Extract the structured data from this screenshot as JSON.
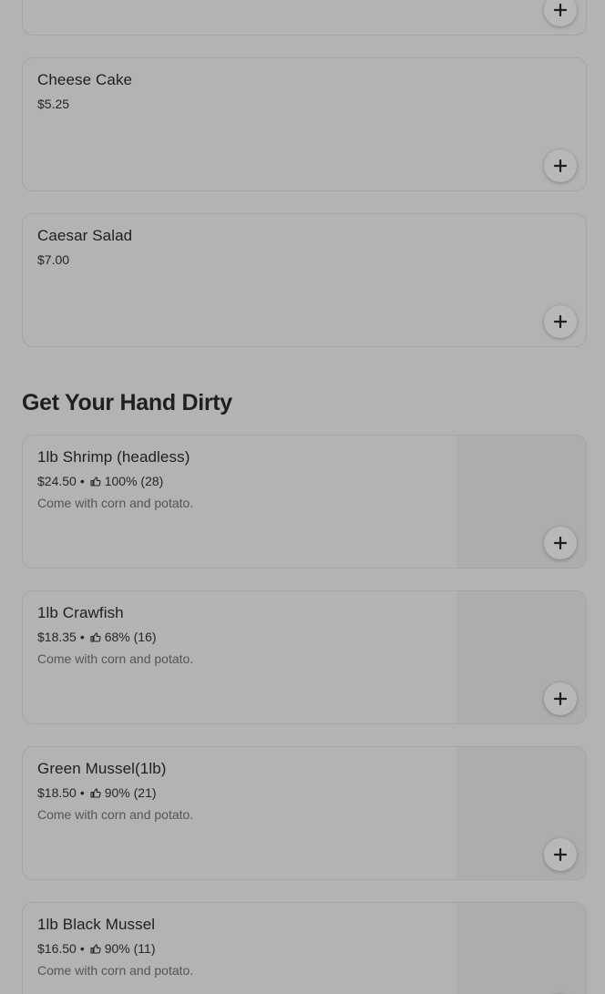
{
  "colors": {
    "overlay_bg": "#b3b3b3",
    "text": "#1f1f1f",
    "muted": "#555555"
  },
  "icons": {
    "add": "plus-icon",
    "rating": "thumbs-up-icon"
  },
  "top_section": {
    "items": [
      {
        "name": "",
        "price": ""
      },
      {
        "name": "Cheese Cake",
        "price": "$5.25"
      },
      {
        "name": "Caesar Salad",
        "price": "$7.00"
      }
    ]
  },
  "section": {
    "title": "Get Your Hand Dirty",
    "items": [
      {
        "name": "1lb Shrimp (headless)",
        "price": "$24.50",
        "rating": "100% (28)",
        "description": "Come with corn and potato."
      },
      {
        "name": "1lb Crawfish",
        "price": "$18.35",
        "rating": "68% (16)",
        "description": "Come with corn and potato."
      },
      {
        "name": "Green Mussel(1lb)",
        "price": "$18.50",
        "rating": "90% (21)",
        "description": "Come with corn and potato."
      },
      {
        "name": "1lb Black Mussel",
        "price": "$16.50",
        "rating": "90% (11)",
        "description": "Come with corn and potato."
      }
    ]
  },
  "separator": "•"
}
